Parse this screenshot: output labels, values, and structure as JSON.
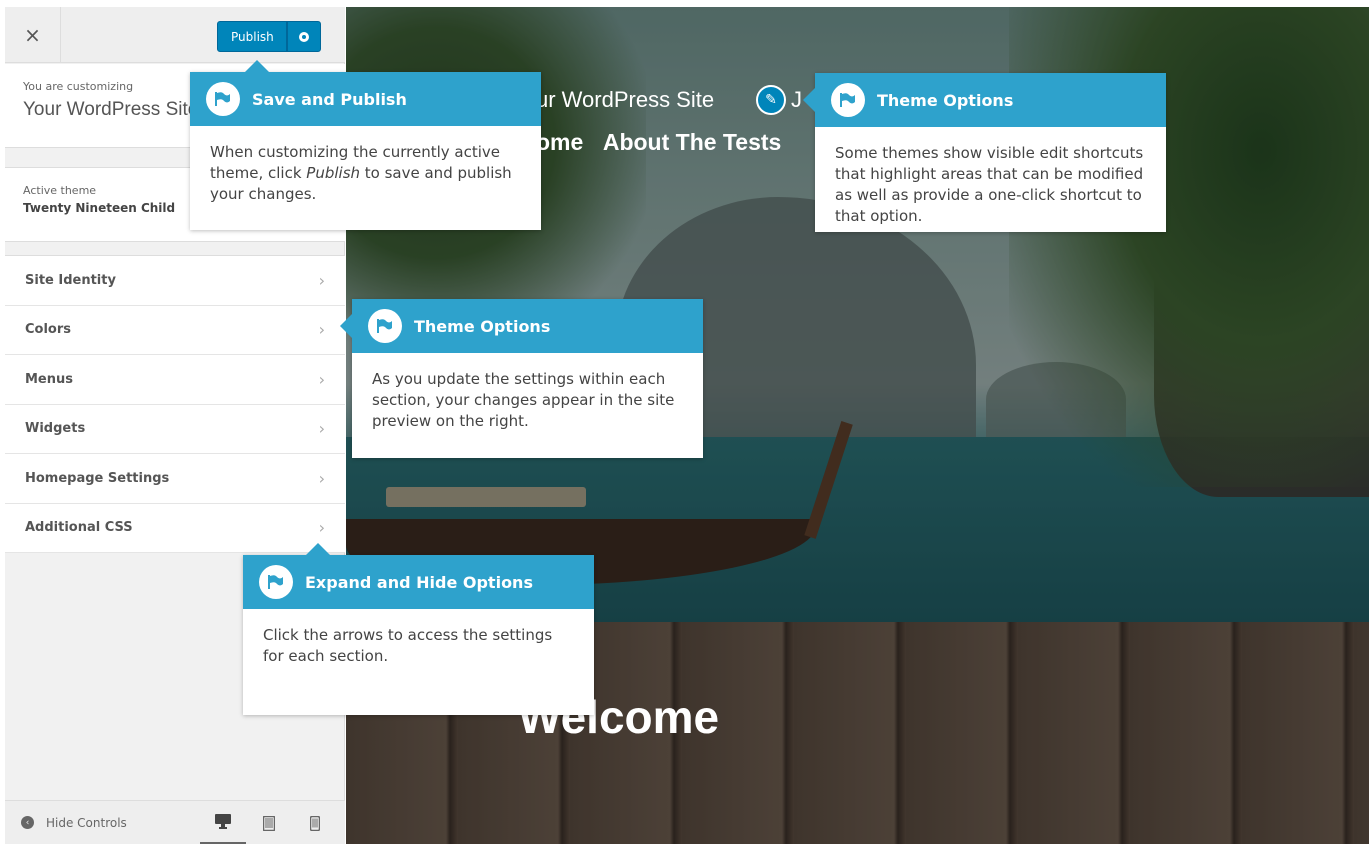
{
  "topbar": {
    "close_icon": "×",
    "publish_label": "Publish",
    "publish_settings_icon": "gear-icon"
  },
  "customizing": {
    "prefix": "You are customizing",
    "site_name": "Your WordPress Site"
  },
  "active_theme": {
    "label": "Active theme",
    "name": "Twenty Nineteen Child"
  },
  "sections": [
    {
      "label": "Site Identity"
    },
    {
      "label": "Colors"
    },
    {
      "label": "Menus"
    },
    {
      "label": "Widgets"
    },
    {
      "label": "Homepage Settings"
    },
    {
      "label": "Additional CSS"
    }
  ],
  "bottombar": {
    "hide_controls": "Hide Controls",
    "devices": [
      "desktop-icon",
      "tablet-icon",
      "mobile-icon"
    ]
  },
  "preview": {
    "site_title": "ur WordPress Site",
    "site_title_suffix": "J",
    "nav": [
      "ome",
      "About The Tests"
    ],
    "welcome": "Welcome"
  },
  "tooltips": {
    "save_publish": {
      "title": "Save and Publish",
      "body_1": "When customizing the currently active theme, click ",
      "body_em": "Publish",
      "body_2": " to save and publish your changes."
    },
    "theme_options_top": {
      "title": "Theme Options",
      "body": "Some themes show visible edit shortcuts that highlight areas that can be modified as well as provide a one-click shortcut to that option."
    },
    "theme_options_mid": {
      "title": "Theme Options",
      "body": "As you update the settings within each section, your changes appear in the site preview on the right."
    },
    "expand_hide": {
      "title": "Expand and Hide Options",
      "body": "Click the arrows to access the settings for each section."
    }
  },
  "colors": {
    "accent": "#2ea2cc",
    "publish": "#0085ba"
  }
}
